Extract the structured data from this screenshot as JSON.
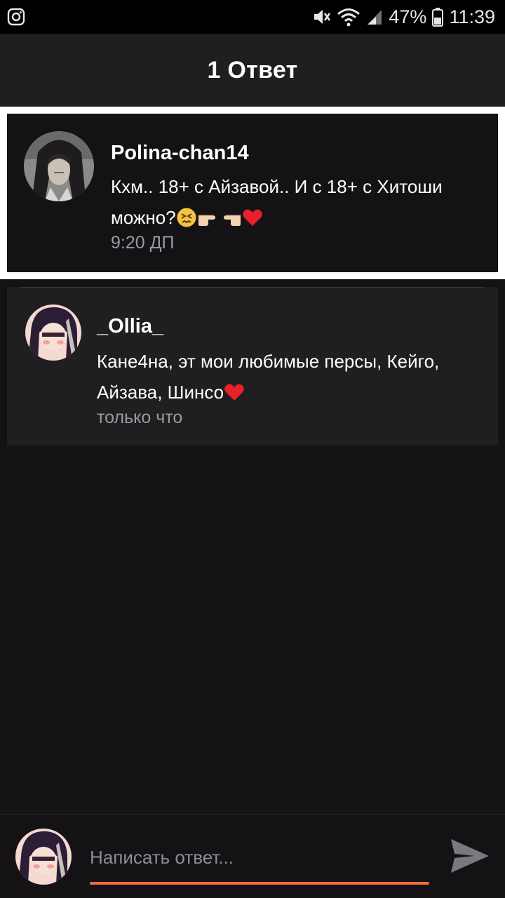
{
  "status_bar": {
    "battery": "47%",
    "time": "11:39",
    "icons": [
      "instagram-icon",
      "mute-icon",
      "wifi-icon",
      "signal-icon",
      "battery-icon"
    ]
  },
  "header": {
    "title": "1 Ответ"
  },
  "parent_comment": {
    "username": "Polina-chan14",
    "text_line1": "Кхм.. 18+ с Айзавой.. И с 18+ с Хитоши",
    "text_line2": "можно?",
    "emojis": [
      "confounded-face",
      "pointing-right",
      "pointing-left",
      "red-heart"
    ],
    "time": "9:20 ДП"
  },
  "reply": {
    "username": "_Ollia_",
    "text_line1": "Кане4на, эт мои любимые персы, Кейго,",
    "text_line2": "Айзава, Шинсо",
    "emojis": [
      "red-heart"
    ],
    "time": "только что"
  },
  "composer": {
    "placeholder": "Написать ответ...",
    "accent_color": "#f26b3a"
  }
}
